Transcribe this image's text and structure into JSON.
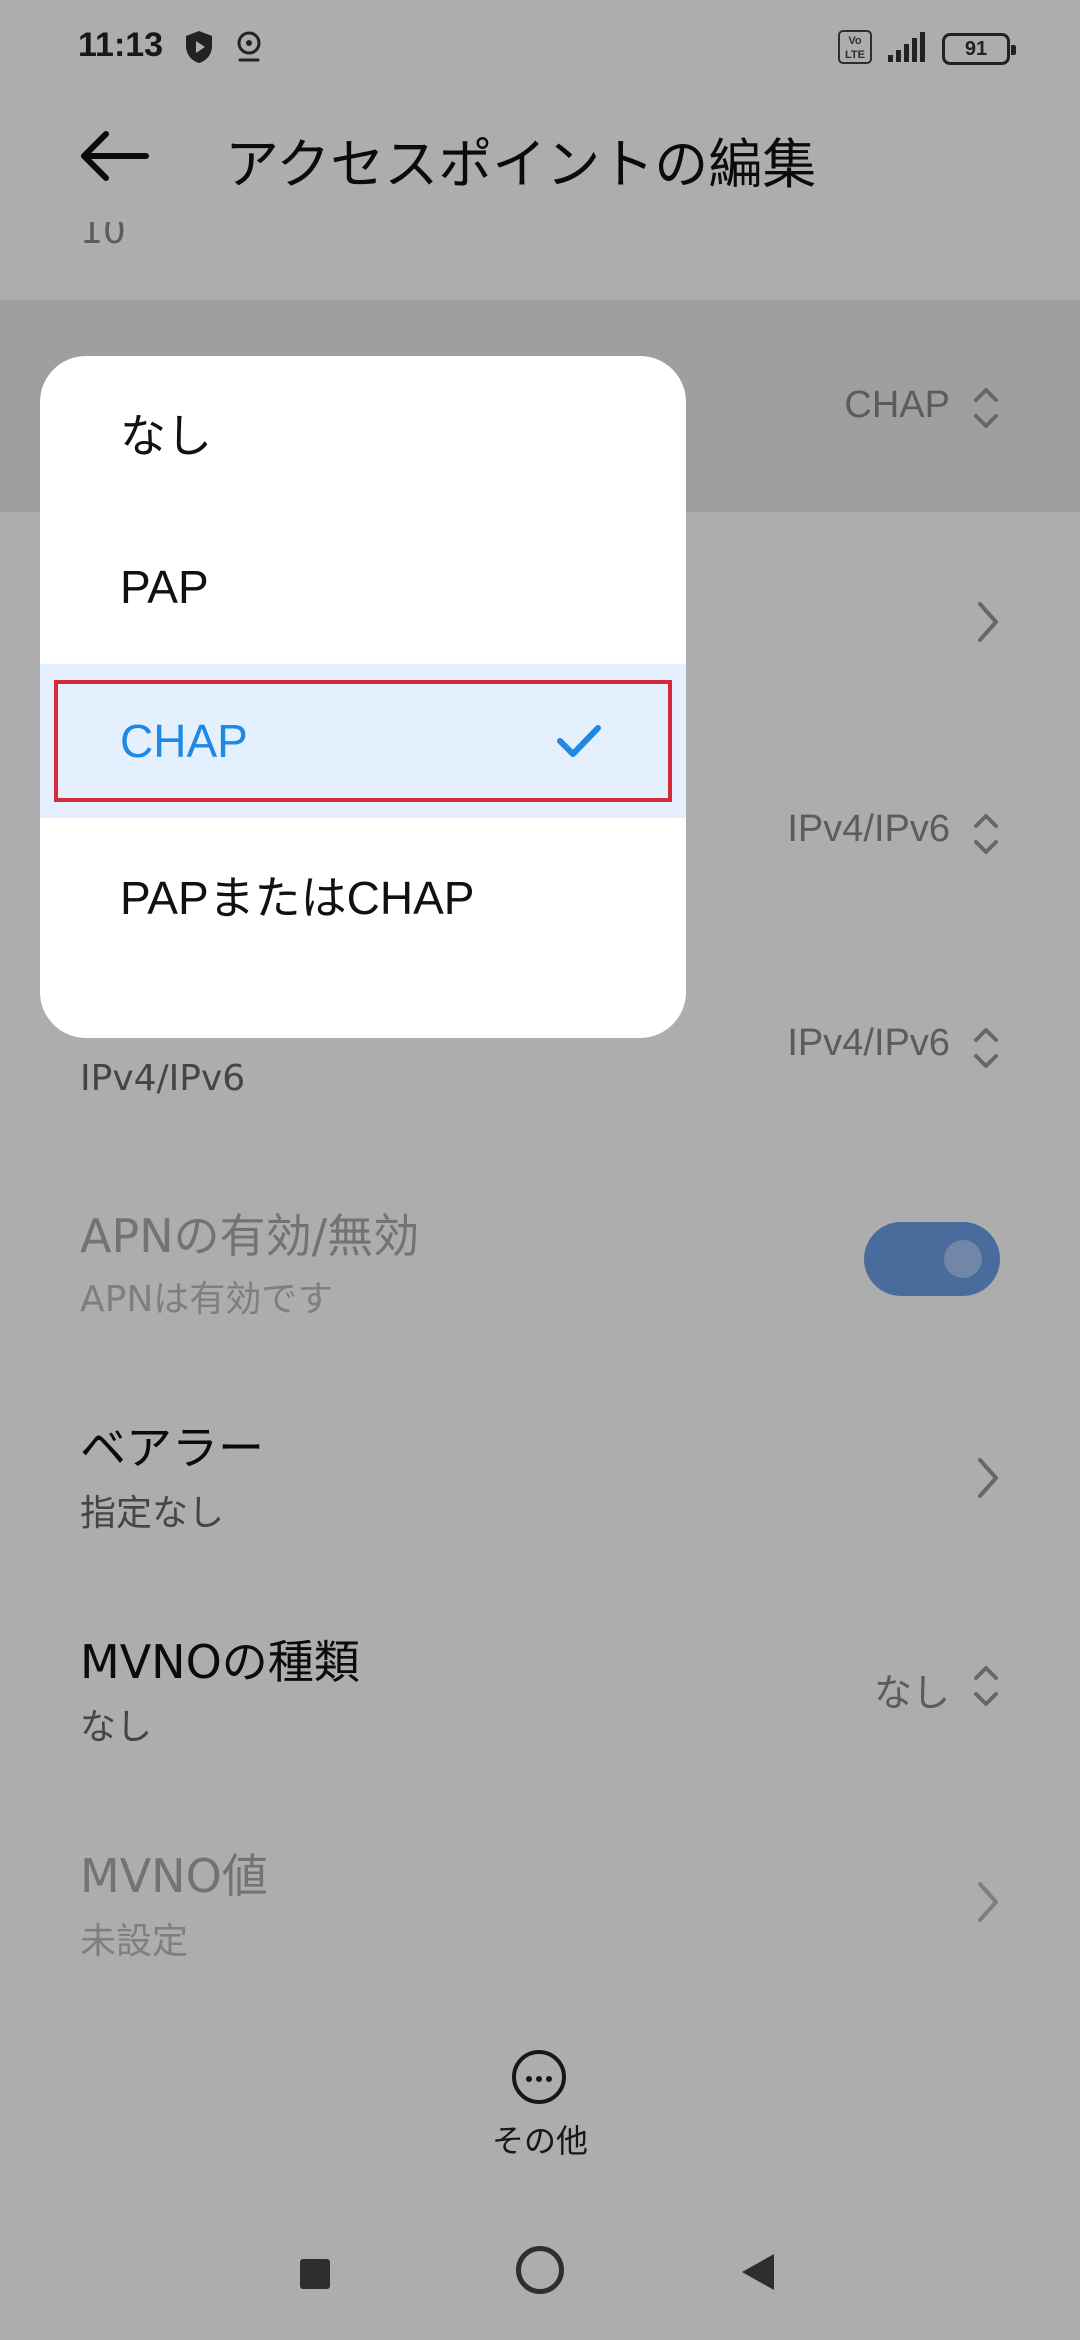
{
  "status_bar": {
    "time": "11:13",
    "battery": "91",
    "network_badge": "Vo LTE"
  },
  "header": {
    "title": "アクセスポイントの編集",
    "cut_text": "10"
  },
  "settings": {
    "auth_type_value": "CHAP",
    "protocol_value": "IPv4/IPv6",
    "roaming_value": "IPv4/IPv6",
    "roaming_sub": "IPv4/IPv6",
    "apn_toggle": {
      "title": "APNの有効/無効",
      "sub": "APNは有効です",
      "enabled": true
    },
    "bearer": {
      "title": "ベアラー",
      "sub": "指定なし"
    },
    "mvno_type": {
      "title": "MVNOの種類",
      "sub": "なし",
      "value": "なし"
    },
    "mvno_value": {
      "title": "MVNO値",
      "sub": "未設定"
    }
  },
  "more": {
    "label": "その他"
  },
  "popup": {
    "options": [
      {
        "label": "なし",
        "selected": false
      },
      {
        "label": "PAP",
        "selected": false
      },
      {
        "label": "CHAP",
        "selected": true
      },
      {
        "label": "PAPまたはCHAP",
        "selected": false
      }
    ]
  },
  "colors": {
    "accent": "#1f87e5",
    "selected_bg": "#e4f0fd",
    "annotation_box": "#d42b3a",
    "toggle_on": "#6ea0e8"
  }
}
